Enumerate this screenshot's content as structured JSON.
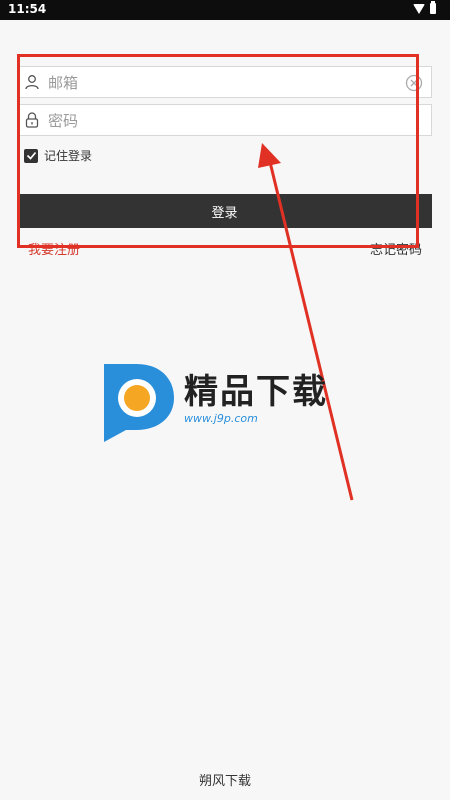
{
  "status_bar": {
    "time": "11:54"
  },
  "form": {
    "email_placeholder": "邮箱",
    "password_placeholder": "密码",
    "remember_label": "记住登录",
    "remember_checked": true,
    "login_label": "登录",
    "register_label": "我要注册",
    "forgot_label": "忘记密码"
  },
  "logo": {
    "title": "精品下载",
    "url": "www.j9p.com"
  },
  "footer": {
    "text": "朔风下载"
  },
  "colors": {
    "button_bg": "#333333",
    "register_link": "#d63a2e",
    "annotation_red": "#e03124",
    "logo_blue": "#2a8fdb",
    "logo_orange": "#f5a623"
  },
  "icons": {
    "email": "person-icon",
    "password": "lock-icon",
    "clear": "clear-icon",
    "checkbox": "checkmark-icon"
  }
}
